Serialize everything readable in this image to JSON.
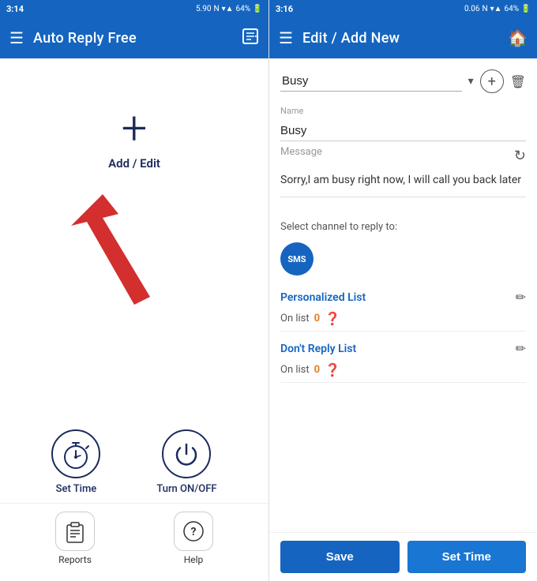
{
  "left": {
    "status_bar": {
      "time": "3:14",
      "icons": "5.90 N 📶 64%"
    },
    "app_bar": {
      "title": "Auto Reply Free",
      "menu_icon": "☰",
      "person_icon": "👤"
    },
    "add_edit": {
      "plus_symbol": "+",
      "label": "Add / Edit"
    },
    "bottom_grid": {
      "set_time_label": "Set Time",
      "turn_onoff_label": "Turn ON/OFF"
    },
    "footer": {
      "reports_label": "Reports",
      "help_label": "Help"
    }
  },
  "right": {
    "status_bar": {
      "time": "3:16",
      "icons": "0.06 N 📶 64%"
    },
    "app_bar": {
      "title": "Edit / Add New",
      "menu_icon": "☰",
      "home_icon": "🏠"
    },
    "dropdown": {
      "selected": "Busy",
      "chevron": "▾"
    },
    "name_label": "Name",
    "name_value": "Busy",
    "message_label": "Message",
    "message_text": "Sorry,I am busy right now, I will call you back later",
    "channel_label": "Select channel to reply to:",
    "sms_label": "SMS",
    "personalized_list_title": "Personalized List",
    "personalized_list_on_list": "On list",
    "personalized_list_count": "0",
    "dont_reply_title": "Don't Reply List",
    "dont_reply_on_list": "On list",
    "dont_reply_count": "0",
    "save_label": "Save",
    "set_time_label": "Set Time"
  }
}
